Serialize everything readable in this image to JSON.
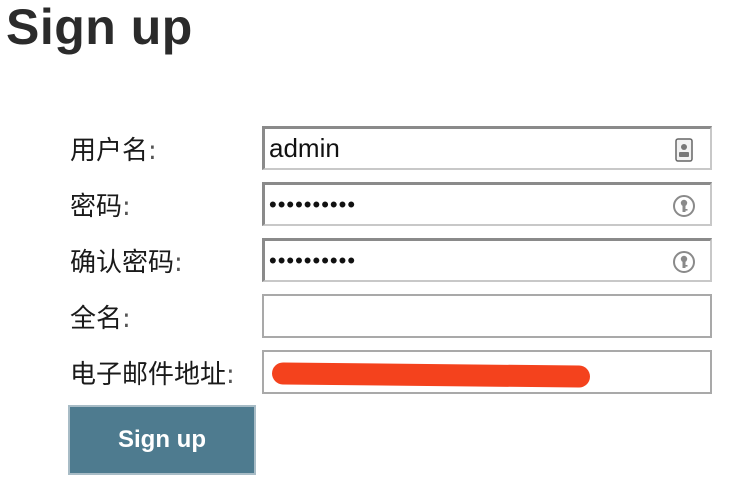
{
  "page": {
    "title": "Sign up"
  },
  "form": {
    "username": {
      "label": "用户名",
      "value": "admin",
      "icon": "contact-card-icon"
    },
    "password": {
      "label": "密码",
      "value": "••••••••••",
      "icon": "key-fill-icon"
    },
    "confirm_password": {
      "label": "确认密码",
      "value": "••••••••••",
      "icon": "key-fill-icon"
    },
    "full_name": {
      "label": "全名",
      "value": ""
    },
    "email": {
      "label": "电子邮件地址",
      "value": ""
    },
    "colon": ":",
    "submit_label": "Sign up"
  },
  "colors": {
    "button": "#4e7b8f",
    "redaction": "#f4421d"
  }
}
